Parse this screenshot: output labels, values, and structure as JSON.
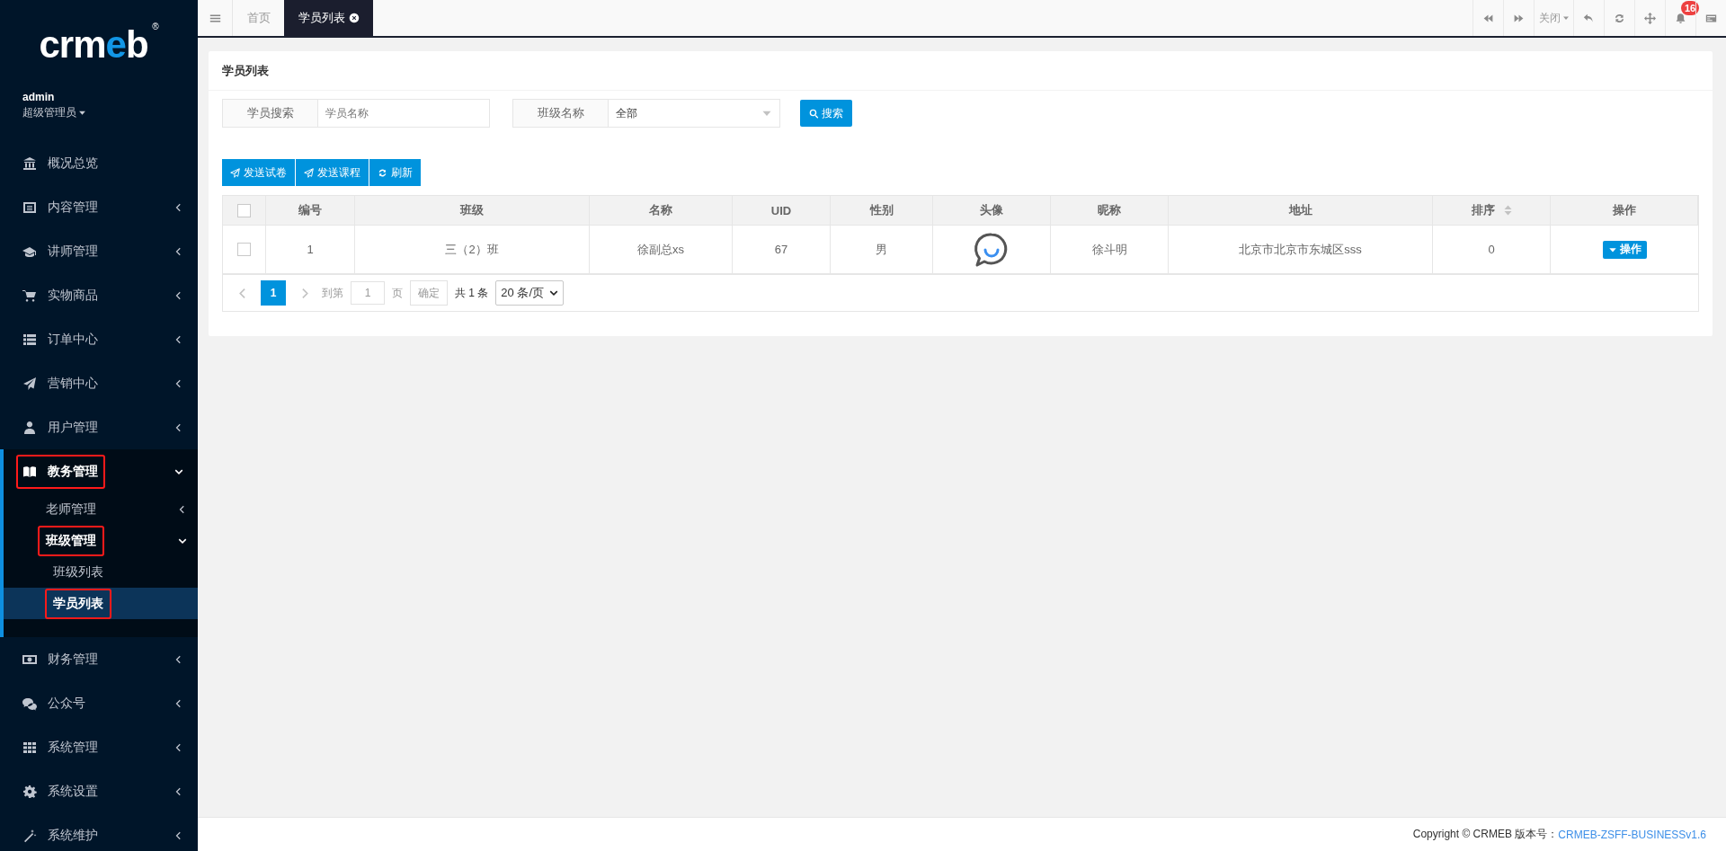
{
  "sidebar": {
    "logo": {
      "parts": [
        {
          "text": "crm",
          "accent": false
        },
        {
          "text": "e",
          "accent": true
        },
        {
          "text": "b",
          "accent": false
        }
      ],
      "mark": "®"
    },
    "user": {
      "name": "admin",
      "role": "超级管理员"
    },
    "menu": [
      {
        "label": "概况总览",
        "kind": "bank",
        "expandable": false,
        "selected": false,
        "highlighted": false
      },
      {
        "label": "内容管理",
        "kind": "newspaper",
        "expandable": true,
        "expanded": false,
        "selected": false,
        "highlighted": false
      },
      {
        "label": "讲师管理",
        "kind": "cap",
        "expandable": true,
        "expanded": false,
        "selected": false,
        "highlighted": false
      },
      {
        "label": "实物商品",
        "kind": "cart",
        "expandable": true,
        "expanded": false,
        "selected": false,
        "highlighted": false
      },
      {
        "label": "订单中心",
        "kind": "list",
        "expandable": true,
        "expanded": false,
        "selected": false,
        "highlighted": false
      },
      {
        "label": "营销中心",
        "kind": "plane",
        "expandable": true,
        "expanded": false,
        "selected": false,
        "highlighted": false
      },
      {
        "label": "用户管理",
        "kind": "user",
        "expandable": true,
        "expanded": false,
        "selected": false,
        "highlighted": false
      },
      {
        "label": "教务管理",
        "kind": "book",
        "expandable": true,
        "expanded": true,
        "selected": false,
        "highlighted": true,
        "children": [
          {
            "label": "老师管理",
            "expandable": true,
            "expanded": false,
            "selected": false,
            "highlighted": false
          },
          {
            "label": "班级管理",
            "expandable": true,
            "expanded": true,
            "selected": false,
            "highlighted": true,
            "children": [
              {
                "label": "班级列表",
                "expandable": false,
                "selected": false,
                "highlighted": false
              },
              {
                "label": "学员列表",
                "expandable": false,
                "selected": true,
                "highlighted": true
              }
            ]
          }
        ]
      },
      {
        "label": "财务管理",
        "kind": "money",
        "expandable": true,
        "expanded": false,
        "selected": false,
        "highlighted": false
      },
      {
        "label": "公众号",
        "kind": "wechat",
        "expandable": true,
        "expanded": false,
        "selected": false,
        "highlighted": false
      },
      {
        "label": "系统管理",
        "kind": "grid",
        "expandable": true,
        "expanded": false,
        "selected": false,
        "highlighted": false
      },
      {
        "label": "系统设置",
        "kind": "gear",
        "expandable": true,
        "expanded": false,
        "selected": false,
        "highlighted": false
      },
      {
        "label": "系统维护",
        "kind": "wand",
        "expandable": true,
        "expanded": false,
        "selected": false,
        "highlighted": false
      }
    ]
  },
  "topbar": {
    "tabs": [
      {
        "label": "首页",
        "selected": false,
        "closable": false
      },
      {
        "label": "学员列表",
        "selected": true,
        "closable": true
      }
    ],
    "tools": [
      {
        "kind": "backward"
      },
      {
        "kind": "forward"
      },
      {
        "kind": "dropdown",
        "label": "关闭"
      },
      {
        "kind": "undo"
      },
      {
        "kind": "refresh"
      },
      {
        "kind": "move"
      },
      {
        "kind": "bell",
        "badge": "16"
      },
      {
        "kind": "cards"
      }
    ]
  },
  "panel": {
    "title": "学员列表",
    "filters": [
      {
        "kind": "text",
        "label": "学员搜索",
        "placeholder": "学员名称"
      },
      {
        "kind": "select",
        "label": "班级名称",
        "value": "全部"
      }
    ],
    "search_button": "搜索",
    "actions": [
      {
        "label": "发送试卷",
        "kind": "send"
      },
      {
        "label": "发送课程",
        "kind": "send"
      },
      {
        "label": "刷新",
        "kind": "refresh"
      }
    ],
    "table": {
      "header_checked": false,
      "columns": [
        {
          "kind": "check"
        },
        {
          "kind": "text",
          "label": "编号",
          "sortable": false
        },
        {
          "kind": "text",
          "label": "班级",
          "sortable": false
        },
        {
          "kind": "text",
          "label": "名称",
          "sortable": false
        },
        {
          "kind": "text",
          "label": "UID",
          "sortable": false
        },
        {
          "kind": "text",
          "label": "性别",
          "sortable": false
        },
        {
          "kind": "avatar",
          "label": "头像",
          "sortable": false
        },
        {
          "kind": "text",
          "label": "昵称",
          "sortable": false
        },
        {
          "kind": "text",
          "label": "地址",
          "sortable": false
        },
        {
          "kind": "text",
          "label": "排序",
          "sortable": true
        },
        {
          "kind": "action",
          "label": "操作",
          "sortable": false
        }
      ],
      "rows": [
        {
          "checked": false,
          "cells": [
            "",
            "1",
            "三（2）班",
            "徐副总xs",
            "67",
            "男",
            "",
            "徐斗明",
            "北京市北京市东城区sss",
            "0",
            "操作"
          ]
        }
      ]
    },
    "pagination": {
      "pages": [
        {
          "label": "1",
          "selected": true
        }
      ],
      "goto_label": "到第",
      "page_value": "1",
      "page_unit": "页",
      "confirm": "确定",
      "total": "共 1 条",
      "page_size": "20 条/页"
    }
  },
  "footer": {
    "copyright": "Copyright © CRMEB 版本号：",
    "version": "CRMEB-ZSFF-BUSINESSv1.6"
  }
}
